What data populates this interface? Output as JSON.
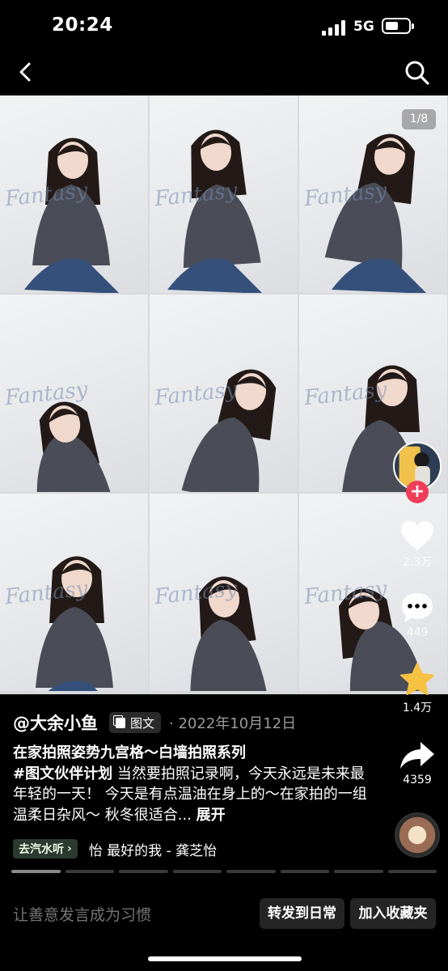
{
  "status_bar": {
    "time": "20:24",
    "network": "5G"
  },
  "nav": {
    "back_icon": "chevron-left-icon",
    "search_icon": "search-icon"
  },
  "gallery": {
    "page_counter": "1/8",
    "watermark": "Fantasy",
    "photo_count": 9
  },
  "actions": {
    "likes": "2.3万",
    "comments": "449",
    "favorites": "1.4万",
    "shares": "4359",
    "follow_symbol": "+"
  },
  "post": {
    "author": "@大余小鱼",
    "type_tag": "图文",
    "date_separator": "·",
    "date": "2022年10月12日",
    "title": "在家拍照姿势九宫格～白墙拍照系列",
    "hashtag": "#图文伙伴计划",
    "body_1": " 当然要拍照记录啊，今天永远是未来最年轻的一天！ 今天是有点温油在身上的～在家拍的一组温柔日杂风～ 秋冬很适合... ",
    "expand": "展开"
  },
  "music": {
    "chip_label": "去汽水听",
    "chip_chevron": "›",
    "track": "怡   最好的我 - 龚芝怡"
  },
  "progress": {
    "segments": 8,
    "active_index": 0
  },
  "comment_bar": {
    "placeholder": "让善意发言成为习惯",
    "repost_label": "转发到日常",
    "collect_label": "加入收藏夹"
  },
  "colors": {
    "accent_red": "#ef3d5a",
    "favorite_yellow": "#f5c242",
    "background": "#000000"
  }
}
